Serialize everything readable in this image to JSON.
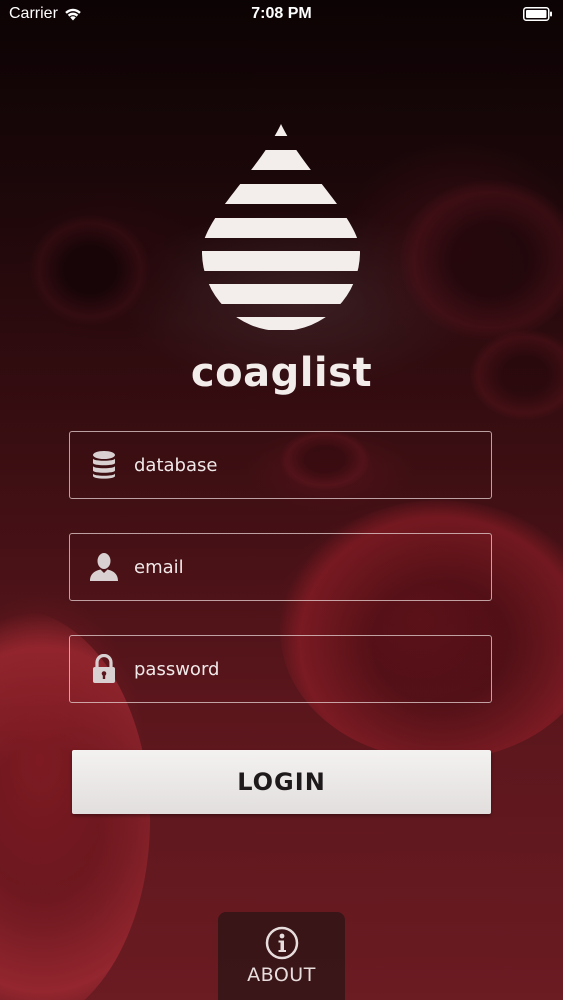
{
  "status_bar": {
    "carrier": "Carrier",
    "time": "7:08 PM"
  },
  "app": {
    "name": "coaglist"
  },
  "form": {
    "database_placeholder": "database",
    "email_placeholder": "email",
    "password_placeholder": "password",
    "login_label": "LOGIN"
  },
  "footer": {
    "about_label": "ABOUT"
  },
  "icons": {
    "wifi": "wifi-icon",
    "battery": "battery-icon",
    "logo": "blood-drop-logo-icon",
    "database": "database-icon",
    "user": "user-icon",
    "lock": "lock-icon",
    "info": "info-icon"
  },
  "colors": {
    "background_top": "#0c0304",
    "background_bottom": "#6b1b22",
    "text_light": "#f2ecea",
    "button_bg": "#f4f1f1",
    "button_text": "#1e1a1b"
  }
}
